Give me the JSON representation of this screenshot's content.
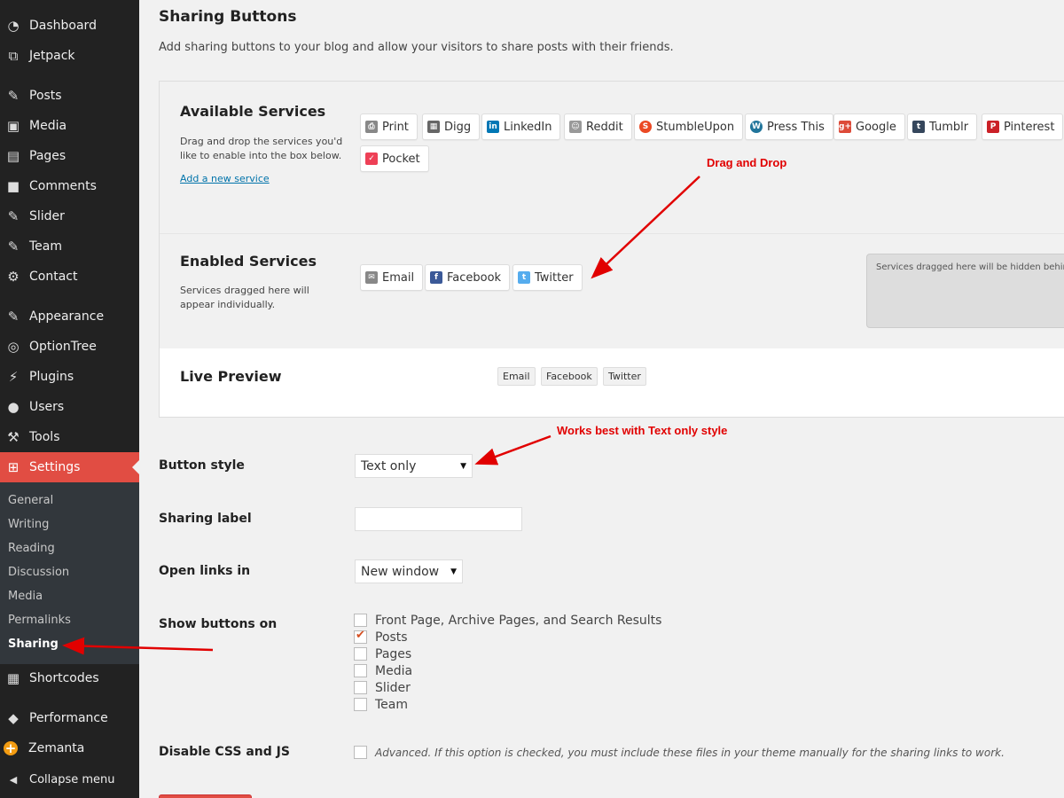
{
  "sidebar": {
    "items": [
      {
        "label": "Dashboard",
        "icon": "dashboard-icon",
        "glyph": "◔"
      },
      {
        "label": "Jetpack",
        "icon": "jetpack-icon",
        "glyph": "⧉"
      },
      {
        "label": "Posts",
        "icon": "pin-icon",
        "glyph": "✎"
      },
      {
        "label": "Media",
        "icon": "media-icon",
        "glyph": "▣"
      },
      {
        "label": "Pages",
        "icon": "pages-icon",
        "glyph": "▤"
      },
      {
        "label": "Comments",
        "icon": "comments-icon",
        "glyph": "■"
      },
      {
        "label": "Slider",
        "icon": "pin-icon",
        "glyph": "✎"
      },
      {
        "label": "Team",
        "icon": "pin-icon",
        "glyph": "✎"
      },
      {
        "label": "Contact",
        "icon": "gear-icon",
        "glyph": "⚙"
      },
      {
        "label": "Appearance",
        "icon": "brush-icon",
        "glyph": "✎"
      },
      {
        "label": "OptionTree",
        "icon": "optiontree-icon",
        "glyph": "◎"
      },
      {
        "label": "Plugins",
        "icon": "plugin-icon",
        "glyph": "⚡"
      },
      {
        "label": "Users",
        "icon": "user-icon",
        "glyph": "●"
      },
      {
        "label": "Tools",
        "icon": "wrench-icon",
        "glyph": "⚒"
      },
      {
        "label": "Settings",
        "icon": "settings-icon",
        "glyph": "⊞"
      },
      {
        "label": "Shortcodes",
        "icon": "shortcodes-icon",
        "glyph": "▦"
      },
      {
        "label": "Performance",
        "icon": "performance-icon",
        "glyph": "◆"
      },
      {
        "label": "Zemanta",
        "icon": "zemanta-icon",
        "glyph": "+"
      },
      {
        "label": "Collapse menu",
        "icon": "collapse-icon",
        "glyph": "◀"
      }
    ],
    "submenu": [
      "General",
      "Writing",
      "Reading",
      "Discussion",
      "Media",
      "Permalinks",
      "Sharing"
    ]
  },
  "page": {
    "title": "Sharing Buttons",
    "description": "Add sharing buttons to your blog and allow your visitors to share posts with their friends."
  },
  "available": {
    "title": "Available Services",
    "description": "Drag and drop the services you'd like to enable into the box below.",
    "add_link": "Add a new service",
    "services": [
      {
        "label": "Print",
        "color": "#888888",
        "glyph": "⎙"
      },
      {
        "label": "Digg",
        "color": "#666666",
        "glyph": "▦"
      },
      {
        "label": "LinkedIn",
        "color": "#0077b5",
        "glyph": "in"
      },
      {
        "label": "Reddit",
        "color": "#999999",
        "glyph": "☺"
      },
      {
        "label": "StumbleUpon",
        "color": "#eb4924",
        "glyph": "S"
      },
      {
        "label": "Press This",
        "color": "#21759b",
        "glyph": "W"
      },
      {
        "label": "Google",
        "color": "#dd4b39",
        "glyph": "g+"
      },
      {
        "label": "Tumblr",
        "color": "#35465c",
        "glyph": "t"
      },
      {
        "label": "Pinterest",
        "color": "#cb2027",
        "glyph": "P"
      },
      {
        "label": "Pocket",
        "color": "#ee4056",
        "glyph": "✓"
      }
    ]
  },
  "enabled": {
    "title": "Enabled Services",
    "description": "Services dragged here will appear individually.",
    "services": [
      {
        "label": "Email",
        "color": "#888888",
        "glyph": "✉"
      },
      {
        "label": "Facebook",
        "color": "#3b5998",
        "glyph": "f"
      },
      {
        "label": "Twitter",
        "color": "#55acee",
        "glyph": "t"
      }
    ],
    "hidden_text": "Services dragged here will be hidden behind"
  },
  "preview": {
    "title": "Live Preview",
    "buttons": [
      "Email",
      "Facebook",
      "Twitter"
    ]
  },
  "form": {
    "button_style_label": "Button style",
    "button_style_value": "Text only",
    "sharing_label_label": "Sharing label",
    "sharing_label_value": "",
    "open_links_label": "Open links in",
    "open_links_value": "New window",
    "show_buttons_label": "Show buttons on",
    "show_buttons_options": [
      {
        "label": "Front Page, Archive Pages, and Search Results",
        "checked": false
      },
      {
        "label": "Posts",
        "checked": true
      },
      {
        "label": "Pages",
        "checked": false
      },
      {
        "label": "Media",
        "checked": false
      },
      {
        "label": "Slider",
        "checked": false
      },
      {
        "label": "Team",
        "checked": false
      }
    ],
    "disable_css_label": "Disable CSS and JS",
    "disable_css_hint": "Advanced. If this option is checked, you must include these files in your theme manually for the sharing links to work."
  },
  "annotations": {
    "drag_drop": "Drag and Drop",
    "text_only": "Works best with Text only style",
    "color": "#e10000"
  }
}
